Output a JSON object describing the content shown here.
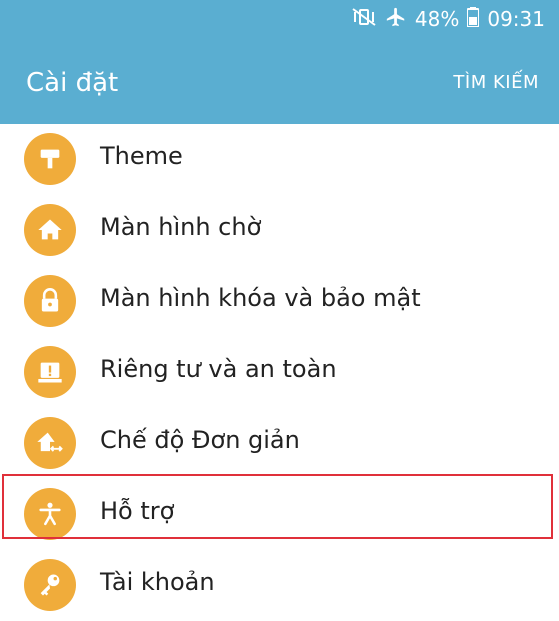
{
  "status": {
    "battery": "48%",
    "time": "09:31",
    "icons": [
      "mute-vibrate-icon",
      "airplane-icon",
      "battery-icon"
    ]
  },
  "appbar": {
    "title": "Cài đặt",
    "search": "TÌM KIẾM"
  },
  "items": [
    {
      "label": "Theme",
      "icon": "paint-roller-icon"
    },
    {
      "label": "Màn hình chờ",
      "icon": "home-icon"
    },
    {
      "label": "Màn hình khóa và bảo mật",
      "icon": "lock-icon"
    },
    {
      "label": "Riêng tư và an toàn",
      "icon": "warning-icon"
    },
    {
      "label": "Chế độ Đơn giản",
      "icon": "home-arrows-icon"
    },
    {
      "label": "Hỗ trợ",
      "icon": "accessibility-icon"
    },
    {
      "label": "Tài khoản",
      "icon": "key-icon"
    }
  ],
  "colors": {
    "appbar": "#5aaed1",
    "icon_bg": "#f0ac3b",
    "highlight": "#e0303a"
  }
}
